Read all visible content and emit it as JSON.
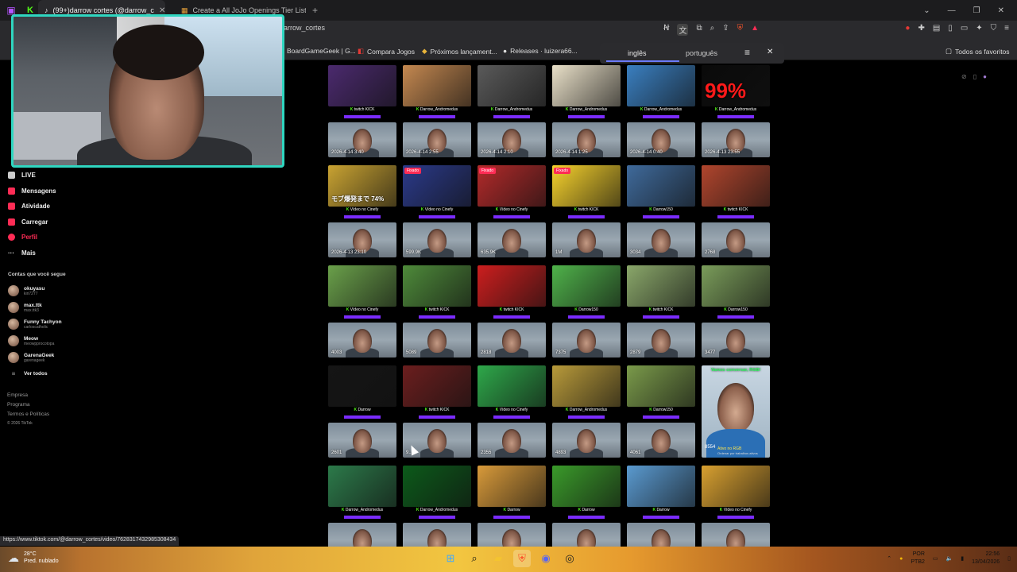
{
  "browser": {
    "tabs": [
      {
        "label": "(99+)darrow cortes (@darrow_c",
        "active": true
      },
      {
        "label": "Create a All JoJo Openings Tier List",
        "active": false
      }
    ],
    "new_tab": "+",
    "url": "darrow_cortes",
    "bookmarks": [
      {
        "label": "BoardGameGeek | G..."
      },
      {
        "label": "Compara Jogos"
      },
      {
        "label": "Próximos lançament..."
      },
      {
        "label": "Releases · luizera66..."
      }
    ],
    "favorites_label": "Todos os favoritos",
    "translate": {
      "lang_a": "inglês",
      "lang_b": "português"
    },
    "status_url": "https://www.tiktok.com/@darrow_cortes/video/7628317432985308434"
  },
  "sidebar": {
    "nav": [
      {
        "label": "LIVE",
        "icon": "live-icon",
        "color": "#cccccc"
      },
      {
        "label": "Mensagens",
        "icon": "messages-icon",
        "color": "#fe2c55"
      },
      {
        "label": "Atividade",
        "icon": "activity-icon",
        "color": "#fe2c55"
      },
      {
        "label": "Carregar",
        "icon": "upload-icon",
        "color": "#fe2c55"
      },
      {
        "label": "Perfil",
        "icon": "profile-icon",
        "color": "#fe2c55"
      },
      {
        "label": "Mais",
        "icon": "more-icon",
        "color": "#cccccc"
      }
    ],
    "followed_title": "Contas que você segue",
    "followed": [
      {
        "name": "okuyasu",
        "sub": "kiri7277"
      },
      {
        "name": "max.ttk",
        "sub": "max.ttk3"
      },
      {
        "name": "Funny Tachyon",
        "sub": "carloscatholic"
      },
      {
        "name": "Meow",
        "sub": "meowpprocotopa"
      },
      {
        "name": "GarenaGeek",
        "sub": "garenageek"
      }
    ],
    "see_all": "Ver todos",
    "footer": [
      "Empresa",
      "Programa",
      "Termos e Políticas",
      "© 2026 TikTok"
    ]
  },
  "grid": {
    "rows": [
      [
        {
          "scene": "#4b2a6e",
          "caption": "twitch KICK",
          "cam": "2026-4-14 3:40"
        },
        {
          "scene": "#c48850",
          "caption": "Darrow_Andromedus",
          "cam": "2026-4-14 2:55"
        },
        {
          "scene": "#5a5a5a",
          "caption": "Darrow_Andromedus",
          "cam": "2026-4-14 2:10"
        },
        {
          "scene": "#e9e0c8",
          "caption": "Darrow_Andromedus",
          "cam": "2026-4-14 1:25"
        },
        {
          "scene": "#3a7fc0",
          "caption": "Darrow_Andromedus",
          "cam": "2026-4-14 0:40"
        },
        {
          "scene": "#0a0a0a",
          "caption": "Darrow_Andromedus",
          "cam": "2026-4-13 23:55",
          "overlay": "99%"
        }
      ],
      [
        {
          "scene": "#c9a332",
          "caption": "Vídeo no Cinefy",
          "cam": "2026-4-13 23:10",
          "overlay": "モブ爆発まで 74%"
        },
        {
          "scene": "#2b3a8a",
          "caption": "Vídeo no Cinefy",
          "cam": "599.9K",
          "pinned": "Fixado"
        },
        {
          "scene": "#b22a2a",
          "caption": "Vídeo no Cinefy",
          "cam": "635.9K",
          "pinned": "Fixado"
        },
        {
          "scene": "#f6d22c",
          "caption": "twitch KICK",
          "cam": "1M",
          "pinned": "Fixado"
        },
        {
          "scene": "#3f6a9b",
          "caption": "Darrow150",
          "cam": "3034"
        },
        {
          "scene": "#b0452d",
          "caption": "twitch KICK",
          "cam": "2768"
        }
      ],
      [
        {
          "scene": "#6aa04a",
          "caption": "Vídeo no Cinefy",
          "cam": "4003"
        },
        {
          "scene": "#4e8a3a",
          "caption": "twitch KICK",
          "cam": "5089"
        },
        {
          "scene": "#cc1e1e",
          "caption": "twitch KICK",
          "cam": "2818"
        },
        {
          "scene": "#4fb24a",
          "caption": "Darrow150",
          "cam": "7375"
        },
        {
          "scene": "#8aa76a",
          "caption": "twitch KICK",
          "cam": "2879"
        },
        {
          "scene": "#7a9c5a",
          "caption": "Darrow150",
          "cam": "3477"
        }
      ],
      [
        {
          "scene": "#151515",
          "caption": "Darrow",
          "cam": "2601"
        },
        {
          "scene": "#6b1e1e",
          "caption": "twitch KICK",
          "cam": "9..."
        },
        {
          "scene": "#2ea84a",
          "caption": "Vídeo no Cinefy",
          "cam": "2355"
        },
        {
          "scene": "#b89a3a",
          "caption": "Darrow_Andromedus",
          "cam": "4893"
        },
        {
          "scene": "#7a9a4a",
          "caption": "Darrow150",
          "cam": "4061"
        },
        {
          "big": true,
          "top": "Vamos conversar, RGB!",
          "cam": "8554",
          "sub": "Ativo no RGB",
          "sub2": "Ordenar por trabalhos ativos"
        }
      ],
      [
        {
          "scene": "#2c7a4a",
          "caption": "Darrow_Andromedus",
          "cam": ""
        },
        {
          "scene": "#0c5a1a",
          "caption": "Darrow_Andromedus",
          "cam": ""
        },
        {
          "scene": "#d89a3a",
          "caption": "Darrow",
          "cam": ""
        },
        {
          "scene": "#3a9a2a",
          "caption": "Darrow",
          "cam": ""
        },
        {
          "scene": "#5a9ad0",
          "caption": "Darrow",
          "cam": ""
        },
        {
          "scene": "#d8a030",
          "caption": "Vídeo no Cinefy",
          "cam": ""
        }
      ]
    ]
  },
  "taskbar": {
    "weather_temp": "28°C",
    "weather_desc": "Pred. nublado",
    "lang": "POR",
    "lang_sub": "PTB2",
    "time": "22:56",
    "date": "13/04/2026"
  }
}
